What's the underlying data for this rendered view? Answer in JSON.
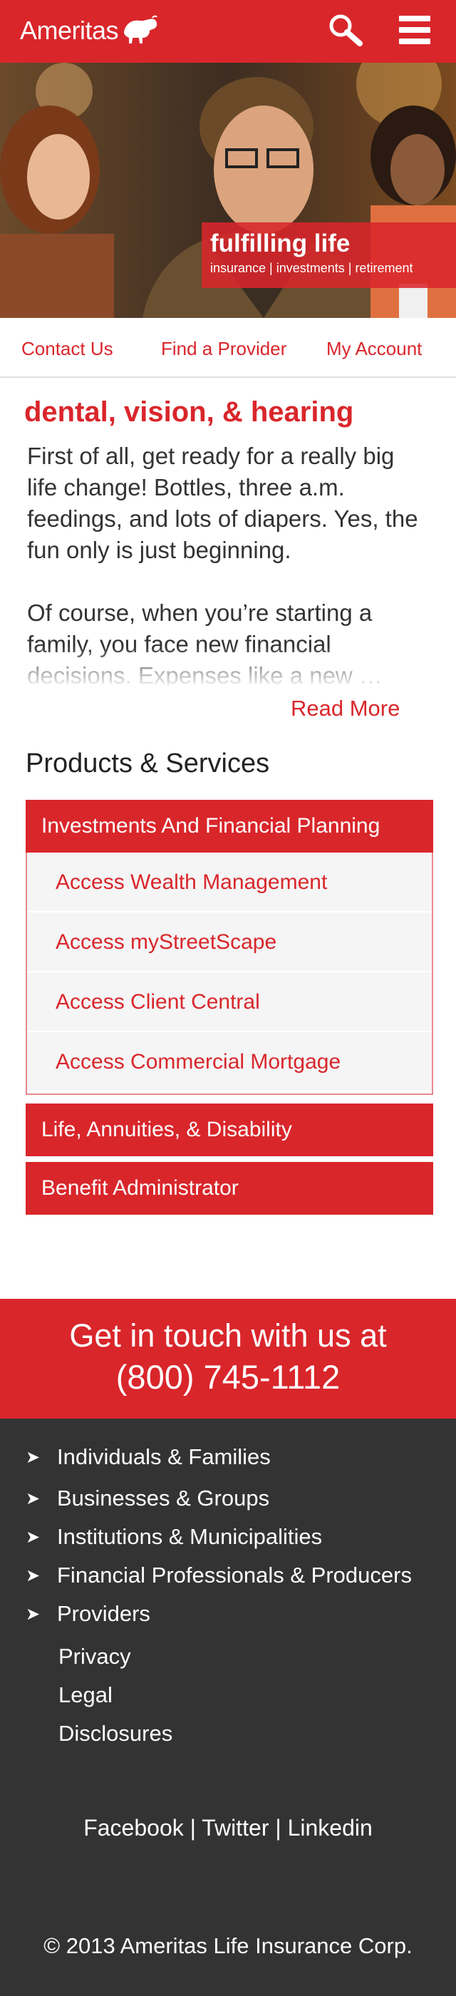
{
  "header": {
    "logo_text": "Ameritas",
    "logo_icon": "bison-icon",
    "search_icon": "search-icon",
    "menu_icon": "hamburger-menu-icon",
    "brand_color": "#d9262b"
  },
  "hero": {
    "title": "fulfilling life",
    "subtitle": "insurance | investments | retirement"
  },
  "quick_links": {
    "contact": "Contact Us",
    "provider": "Find a Provider",
    "account": "My Account"
  },
  "intro": {
    "title": "dental, vision, & hearing",
    "paragraph1": "First of all, get ready for a really big life change! Bottles, three a.m. feedings, and lots of diapers. Yes, the fun only is just beginning.",
    "paragraph2": "Of course, when you’re starting a family, you face new financial decisions. Expenses like a new …",
    "read_more": "Read More"
  },
  "products": {
    "title": "Products & Services",
    "groups": [
      {
        "label": "Investments And Financial Planning"
      },
      {
        "label": "Life, Annuities, & Disability"
      },
      {
        "label": "Benefit Administrator"
      }
    ],
    "sub_items": [
      {
        "label": "Access Wealth Management"
      },
      {
        "label": "Access myStreetScape"
      },
      {
        "label": "Access Client Central"
      },
      {
        "label": "Access Commercial Mortgage"
      }
    ]
  },
  "contact": {
    "line": "Get in touch with us at",
    "phone": "(800) 745-1112"
  },
  "footer": {
    "arrow": "➤",
    "nav": [
      {
        "label": "Individuals & Families"
      },
      {
        "label": "Businesses & Groups"
      },
      {
        "label": "Institutions & Municipalities"
      },
      {
        "label": "Financial Professionals & Producers"
      },
      {
        "label": "Providers"
      }
    ],
    "links": [
      {
        "label": "Privacy"
      },
      {
        "label": "Legal"
      },
      {
        "label": "Disclosures"
      }
    ],
    "social": {
      "facebook": "Facebook",
      "twitter": "Twitter",
      "linkedin": "Linkedin",
      "separator": "|"
    },
    "copyright": "© 2013 Ameritas Life Insurance Corp."
  }
}
